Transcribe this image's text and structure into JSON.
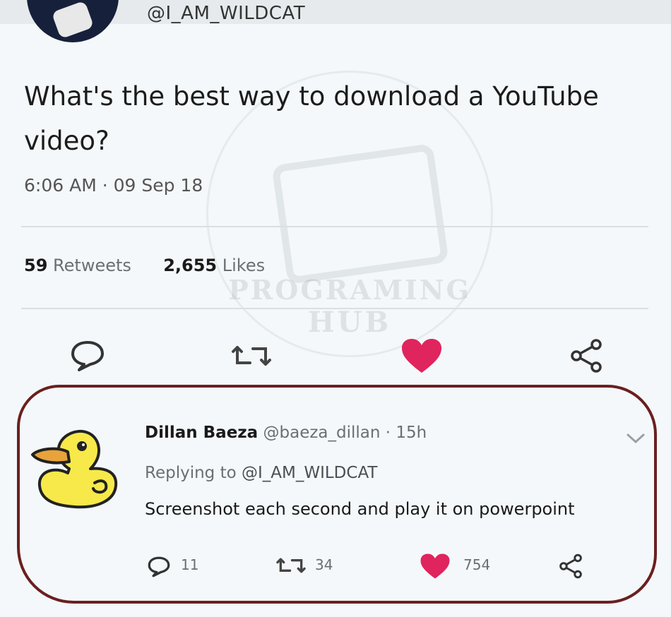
{
  "tweet": {
    "handle": "@I_AM_WILDCAT",
    "text": "What's the best way to download a YouTube video?",
    "time": "6:06 AM · 09 Sep 18",
    "retweets_count": "59",
    "retweets_label": "Retweets",
    "likes_count": "2,655",
    "likes_label": "Likes"
  },
  "watermark": {
    "title": "PROGRAMING",
    "subtitle": "HUB"
  },
  "reply": {
    "name": "Dillan Baeza",
    "handle": "@baeza_dillan",
    "age": "15h",
    "replying_prefix": "Replying to",
    "replying_to": "@I_AM_WILDCAT",
    "text": "Screenshot each second and play it on powerpoint",
    "replies_count": "11",
    "retweets_count": "34",
    "likes_count": "754"
  },
  "colors": {
    "like_active": "#e0245e",
    "circle_annotation": "#6a1f1f"
  },
  "icons": {
    "reply": "reply-icon",
    "retweet": "retweet-icon",
    "like": "heart-icon",
    "share": "share-icon",
    "more": "chevron-down-icon"
  }
}
